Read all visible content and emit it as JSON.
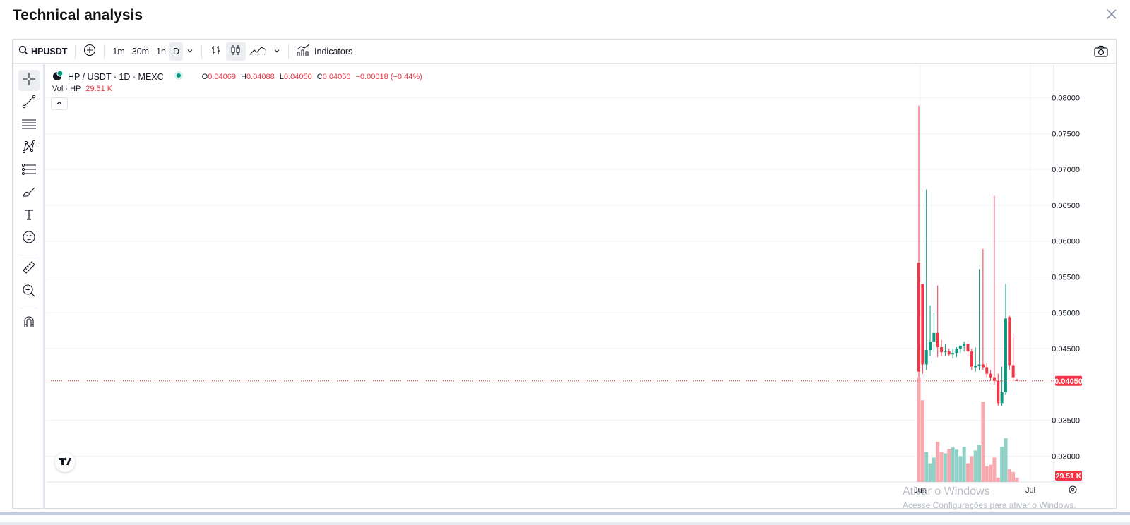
{
  "modal": {
    "title": "Technical analysis"
  },
  "toolbar": {
    "symbol": "HPUSDT",
    "intervals": [
      "1m",
      "30m",
      "1h",
      "D"
    ],
    "active_interval": "D",
    "indicators_label": "Indicators"
  },
  "legend": {
    "title": "HP / USDT · 1D · MEXC",
    "o_label": "O",
    "o_value": "0.04069",
    "h_label": "H",
    "h_value": "0.04088",
    "l_label": "L",
    "l_value": "0.04050",
    "c_label": "C",
    "c_value": "0.04050",
    "change": "−0.00018 (−0.44%)",
    "vol_label": "Vol · HP",
    "vol_value": "29.51 K"
  },
  "colors": {
    "up": "#089981",
    "down": "#f23645",
    "up_vol": "#8fd1c6",
    "down_vol": "#f7a9ae"
  },
  "chart_data": {
    "type": "candlestick",
    "y_ticks": [
      "0.08000",
      "0.07500",
      "0.07000",
      "0.06500",
      "0.06000",
      "0.05500",
      "0.05000",
      "0.04500",
      "0.03500",
      "0.03000"
    ],
    "ylim": [
      0.0264,
      0.0837
    ],
    "x_labels": [
      "Jun",
      "Jul"
    ],
    "last_price": "0.04050",
    "last_volume": "29.51 K",
    "candles": [
      {
        "o": 0.057,
        "h": 0.0789,
        "l": 0.041,
        "c": 0.0418
      },
      {
        "o": 0.054,
        "h": 0.054,
        "l": 0.0415,
        "c": 0.0428
      },
      {
        "o": 0.0428,
        "h": 0.0672,
        "l": 0.042,
        "c": 0.0448
      },
      {
        "o": 0.0448,
        "h": 0.051,
        "l": 0.044,
        "c": 0.046
      },
      {
        "o": 0.046,
        "h": 0.05,
        "l": 0.0445,
        "c": 0.0472
      },
      {
        "o": 0.0472,
        "h": 0.0538,
        "l": 0.0438,
        "c": 0.0452
      },
      {
        "o": 0.0452,
        "h": 0.0462,
        "l": 0.044,
        "c": 0.0445
      },
      {
        "o": 0.0445,
        "h": 0.0456,
        "l": 0.044,
        "c": 0.0446
      },
      {
        "o": 0.0446,
        "h": 0.045,
        "l": 0.044,
        "c": 0.0442
      },
      {
        "o": 0.0442,
        "h": 0.045,
        "l": 0.0436,
        "c": 0.0444
      },
      {
        "o": 0.0444,
        "h": 0.0452,
        "l": 0.0438,
        "c": 0.045
      },
      {
        "o": 0.045,
        "h": 0.0455,
        "l": 0.0444,
        "c": 0.0454
      },
      {
        "o": 0.0454,
        "h": 0.046,
        "l": 0.0446,
        "c": 0.0456
      },
      {
        "o": 0.0456,
        "h": 0.0458,
        "l": 0.044,
        "c": 0.0446
      },
      {
        "o": 0.0446,
        "h": 0.045,
        "l": 0.042,
        "c": 0.0425
      },
      {
        "o": 0.0424,
        "h": 0.0452,
        "l": 0.0418,
        "c": 0.0426
      },
      {
        "o": 0.0426,
        "h": 0.0561,
        "l": 0.042,
        "c": 0.0428
      },
      {
        "o": 0.0428,
        "h": 0.0589,
        "l": 0.042,
        "c": 0.0424
      },
      {
        "o": 0.0424,
        "h": 0.043,
        "l": 0.041,
        "c": 0.0415
      },
      {
        "o": 0.0415,
        "h": 0.042,
        "l": 0.0405,
        "c": 0.041
      },
      {
        "o": 0.041,
        "h": 0.0663,
        "l": 0.04,
        "c": 0.0405
      },
      {
        "o": 0.0405,
        "h": 0.0415,
        "l": 0.037,
        "c": 0.0374
      },
      {
        "o": 0.0374,
        "h": 0.0425,
        "l": 0.037,
        "c": 0.0389
      },
      {
        "o": 0.0389,
        "h": 0.054,
        "l": 0.0385,
        "c": 0.0492
      },
      {
        "o": 0.0494,
        "h": 0.0496,
        "l": 0.042,
        "c": 0.0427
      },
      {
        "o": 0.0427,
        "h": 0.047,
        "l": 0.0405,
        "c": 0.041
      },
      {
        "o": 0.0406,
        "h": 0.0408,
        "l": 0.0405,
        "c": 0.0405
      }
    ],
    "volumes": [
      0.041,
      0.0378,
      0.0306,
      0.029,
      0.0298,
      0.032,
      0.0306,
      0.0304,
      0.031,
      0.0312,
      0.0309,
      0.03,
      0.0313,
      0.029,
      0.03,
      0.0308,
      0.0316,
      0.0376,
      0.0286,
      0.0288,
      0.0298,
      0.027,
      0.0313,
      0.0325,
      0.0282,
      0.0278,
      0.027
    ]
  },
  "watermark": {
    "line1": "Ativar o Windows",
    "line2": "Acesse Configurações para ativar o Windows."
  }
}
